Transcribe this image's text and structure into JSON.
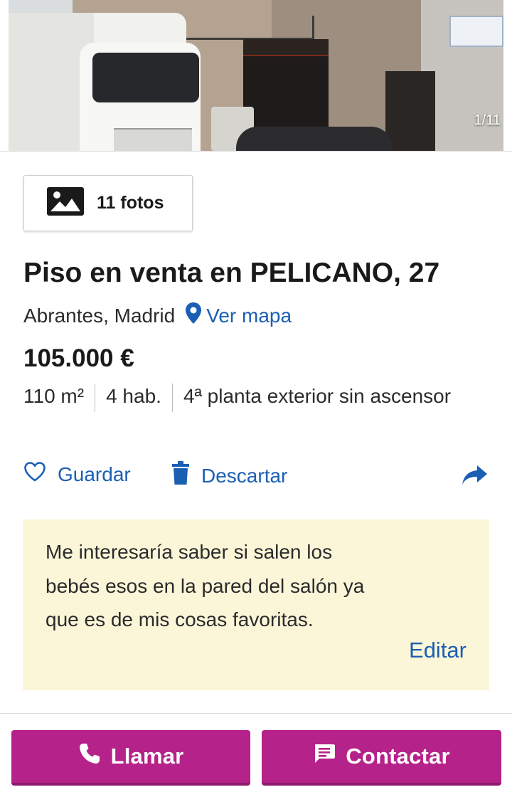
{
  "gallery": {
    "counter": "1/11",
    "photos_button_label": "11 fotos",
    "photos_icon": "image-icon"
  },
  "listing": {
    "title": "Piso en venta en PELICANO, 27",
    "location": "Abrantes, Madrid",
    "map_link": "Ver mapa",
    "price": "105.000 €",
    "features": [
      "110 m²",
      "4 hab.",
      "4ª planta exterior sin ascensor"
    ]
  },
  "actions": {
    "save_label": "Guardar",
    "discard_label": "Descartar",
    "save_icon": "heart-outline-icon",
    "discard_icon": "trash-icon",
    "share_icon": "share-arrow-icon"
  },
  "note": {
    "text": "Me interesaría saber si salen los bebés esos en la pared del salón ya que es de mis cosas favoritas.",
    "edit_label": "Editar"
  },
  "bottom_bar": {
    "call_label": "Llamar",
    "contact_label": "Contactar",
    "call_icon": "phone-icon",
    "contact_icon": "chat-icon"
  },
  "colors": {
    "link": "#1a5fb4",
    "cta": "#b5228a",
    "note_background": "#fcf6d9"
  }
}
